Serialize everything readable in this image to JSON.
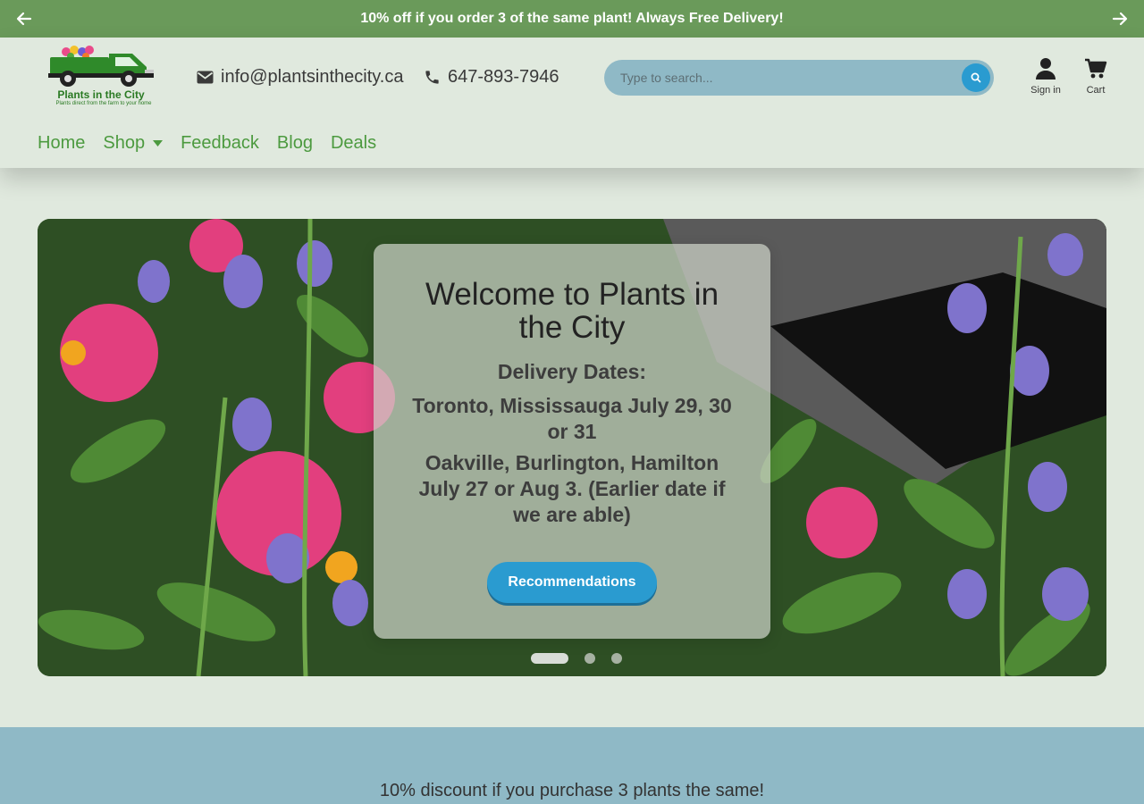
{
  "announcement": {
    "text": "10% off if you order 3 of the same plant! Always Free Delivery!"
  },
  "logo": {
    "name": "Plants in the City",
    "tagline": "Plants direct from the farm to your home"
  },
  "contact": {
    "email": "info@plantsinthecity.ca",
    "phone": "647-893-7946"
  },
  "search": {
    "placeholder": "Type to search..."
  },
  "account": {
    "signin_label": "Sign in",
    "cart_label": "Cart"
  },
  "nav": {
    "home": "Home",
    "shop": "Shop",
    "feedback": "Feedback",
    "blog": "Blog",
    "deals": "Deals"
  },
  "hero": {
    "title": "Welcome to Plants in the City",
    "subtitle": "Delivery Dates:",
    "line1": "Toronto, Mississauga July 29, 30 or 31",
    "line2": "Oakville, Burlington, Hamilton July 27 or Aug 3. (Earlier date if we are able)",
    "button": "Recommendations",
    "slides_total": 3,
    "active_slide": 1
  },
  "promo": {
    "text": "10% discount if you purchase 3 plants the same!"
  },
  "colors": {
    "announcement_bg": "#6a9a5a",
    "nav_link": "#4c9a3f",
    "accent": "#2a9bd0",
    "promo_bg": "#8fb9c6",
    "page_bg": "#e0e9de"
  }
}
